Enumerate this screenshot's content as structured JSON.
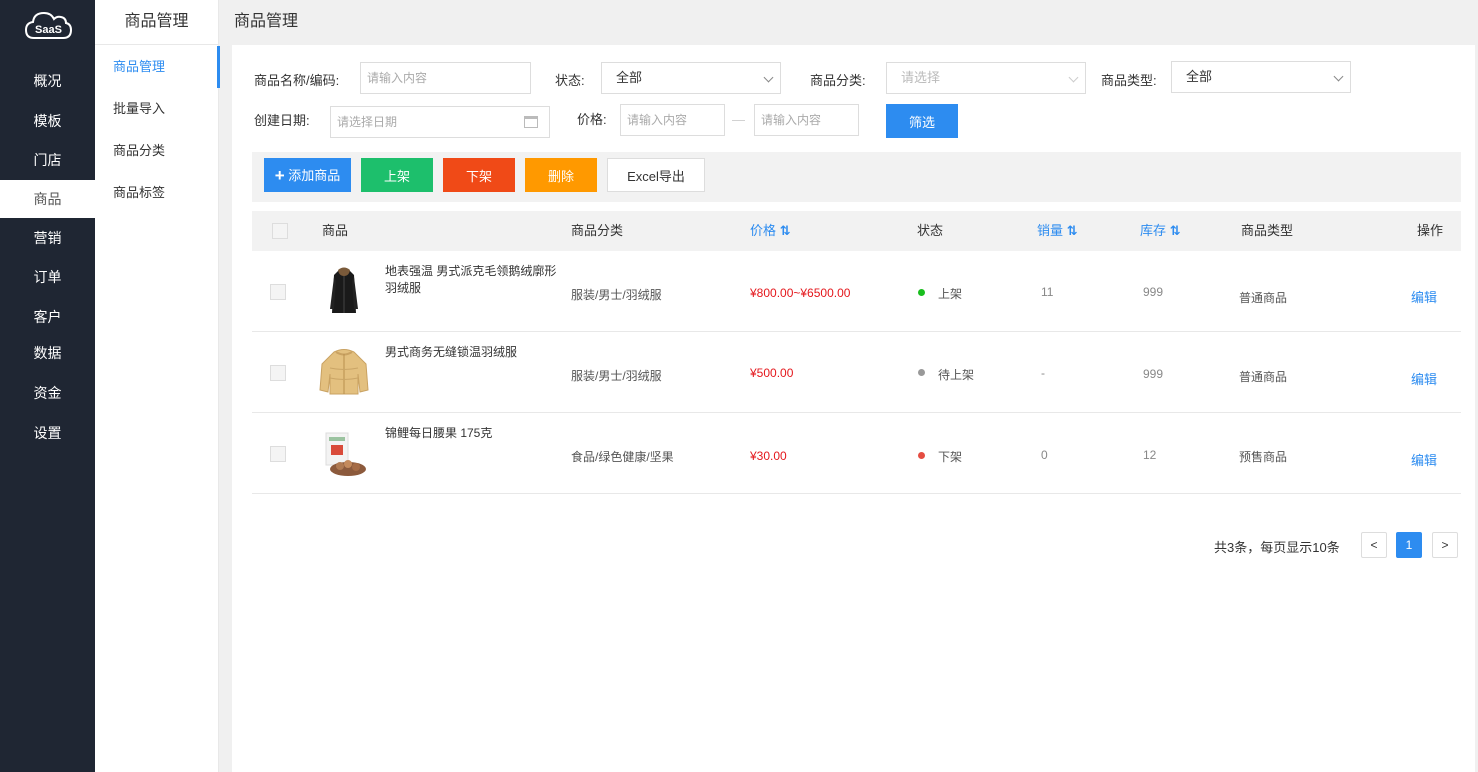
{
  "nav": {
    "logo_text": "SaaS",
    "items": [
      {
        "label": "概况",
        "active": false
      },
      {
        "label": "模板",
        "active": false
      },
      {
        "label": "门店",
        "active": false
      },
      {
        "label": "商品",
        "active": true
      },
      {
        "label": "营销",
        "active": false
      },
      {
        "label": "订单",
        "active": false
      },
      {
        "label": "客户",
        "active": false
      },
      {
        "label": "数据",
        "active": false
      },
      {
        "label": "资金",
        "active": false
      },
      {
        "label": "设置",
        "active": false
      }
    ]
  },
  "submenu": {
    "title": "商品管理",
    "items": [
      {
        "label": "商品管理",
        "active": true
      },
      {
        "label": "批量导入",
        "active": false
      },
      {
        "label": "商品分类",
        "active": false
      },
      {
        "label": "商品标签",
        "active": false
      }
    ]
  },
  "header": {
    "title": "商品管理"
  },
  "filters": {
    "name_label": "商品名称/编码:",
    "name_placeholder": "请输入内容",
    "status_label": "状态:",
    "status_value": "全部",
    "category_label": "商品分类:",
    "category_placeholder": "请选择",
    "type_label": "商品类型:",
    "type_value": "全部",
    "date_label": "创建日期:",
    "date_placeholder": "请选择日期",
    "price_label": "价格:",
    "price_min_placeholder": "请输入内容",
    "price_sep": "—",
    "price_max_placeholder": "请输入内容",
    "filter_button": "筛选"
  },
  "toolbar": {
    "add_icon": "+",
    "add_label": "添加商品",
    "on_label": "上架",
    "off_label": "下架",
    "delete_label": "删除",
    "export_label": "Excel导出",
    "colors": {
      "add": "#2d8cf0",
      "on": "#1dbf6c",
      "off": "#f04a17",
      "delete": "#ff9900"
    }
  },
  "table": {
    "headers": {
      "product": "商品",
      "category": "商品分类",
      "price": "价格",
      "status": "状态",
      "sales": "销量",
      "stock": "库存",
      "type": "商品类型",
      "action": "操作"
    },
    "sort_icon": "⇅",
    "rows": [
      {
        "name": "地表强温 男式派克毛领鹅绒廓形羽绒服",
        "thumb_icon": "black-down-coat-image",
        "category": "服装/男士/羽绒服",
        "price": "¥800.00~¥6500.00",
        "status": "上架",
        "status_color": "#19be1e",
        "sales": "11",
        "stock": "999",
        "type": "普通商品",
        "action": "编辑"
      },
      {
        "name": "男式商务无缝锁温羽绒服",
        "thumb_icon": "yellow-down-jacket-image",
        "category": "服装/男士/羽绒服",
        "price": "¥500.00",
        "status": "待上架",
        "status_color": "#999999",
        "sales": "-",
        "stock": "999",
        "type": "普通商品",
        "action": "编辑"
      },
      {
        "name": "锦鲤每日腰果 175克",
        "thumb_icon": "nut-snack-package-image",
        "category": "食品/绿色健康/坚果",
        "price": "¥30.00",
        "status": "下架",
        "status_color": "#e54d42",
        "sales": "0",
        "stock": "12",
        "type": "预售商品",
        "action": "编辑"
      }
    ]
  },
  "pagination": {
    "summary": "共3条，每页显示10条",
    "prev": "<",
    "current": "1",
    "next": ">"
  }
}
